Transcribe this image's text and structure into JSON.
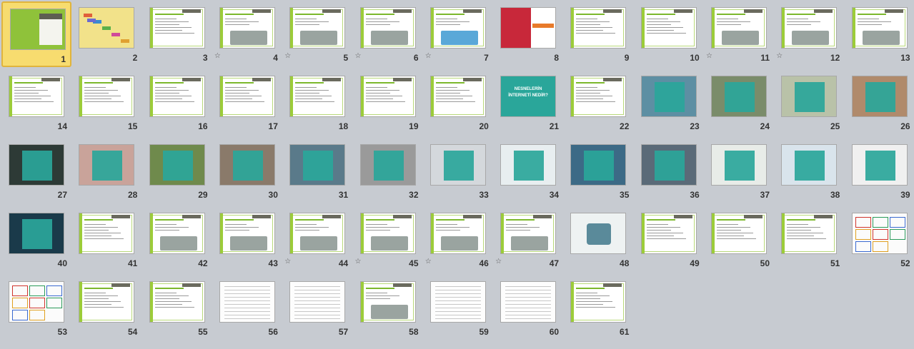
{
  "app": {
    "view": "slide-sorter",
    "accent_color": "#7cb82c",
    "teal_color": "#2aa69a",
    "selected_slide": "1"
  },
  "slides": [
    {
      "number": "1",
      "style": "title-green",
      "star": false
    },
    {
      "number": "2",
      "style": "mindmap",
      "star": false
    },
    {
      "number": "3",
      "style": "text",
      "star": false
    },
    {
      "number": "4",
      "style": "text-image",
      "star": true
    },
    {
      "number": "5",
      "style": "text-image",
      "star": true
    },
    {
      "number": "6",
      "style": "text-image",
      "star": true
    },
    {
      "number": "7",
      "style": "diagram",
      "star": true
    },
    {
      "number": "8",
      "style": "red-image",
      "star": false
    },
    {
      "number": "9",
      "style": "text",
      "star": false
    },
    {
      "number": "10",
      "style": "text",
      "star": false
    },
    {
      "number": "11",
      "style": "text-image",
      "star": true
    },
    {
      "number": "12",
      "style": "text-image",
      "star": true
    },
    {
      "number": "13",
      "style": "text-image",
      "star": false
    },
    {
      "number": "14",
      "style": "text",
      "star": false
    },
    {
      "number": "15",
      "style": "text",
      "star": false
    },
    {
      "number": "16",
      "style": "text",
      "star": false
    },
    {
      "number": "17",
      "style": "text",
      "star": false
    },
    {
      "number": "18",
      "style": "text",
      "star": false
    },
    {
      "number": "19",
      "style": "text",
      "star": false
    },
    {
      "number": "20",
      "style": "text",
      "star": false
    },
    {
      "number": "21",
      "style": "teal-title",
      "star": false,
      "text": "NESNELERİN İNTERNETİ NEDİR?"
    },
    {
      "number": "22",
      "style": "text",
      "star": false
    },
    {
      "number": "23",
      "style": "photo-teal",
      "star": false,
      "photo": "#5d8fa3"
    },
    {
      "number": "24",
      "style": "photo-teal",
      "star": false,
      "photo": "#7a8c6a"
    },
    {
      "number": "25",
      "style": "photo-teal",
      "star": false,
      "photo": "#b9c2a8"
    },
    {
      "number": "26",
      "style": "photo-teal",
      "star": false,
      "photo": "#b08a6b"
    },
    {
      "number": "27",
      "style": "photo-teal",
      "star": false,
      "photo": "#2d3a36"
    },
    {
      "number": "28",
      "style": "photo-teal",
      "star": false,
      "photo": "#c9a39a"
    },
    {
      "number": "29",
      "style": "photo-teal",
      "star": false,
      "photo": "#6f8a4c"
    },
    {
      "number": "30",
      "style": "photo-teal",
      "star": false,
      "photo": "#8a7a6a"
    },
    {
      "number": "31",
      "style": "photo-teal",
      "star": false,
      "photo": "#5a7a8a"
    },
    {
      "number": "32",
      "style": "photo-teal",
      "star": false,
      "photo": "#9a9a9a"
    },
    {
      "number": "33",
      "style": "photo-teal",
      "star": false,
      "photo": "#d4d8dc"
    },
    {
      "number": "34",
      "style": "photo-teal",
      "star": false,
      "photo": "#e8eef0"
    },
    {
      "number": "35",
      "style": "photo-teal",
      "star": false,
      "photo": "#3c6a86"
    },
    {
      "number": "36",
      "style": "photo-teal",
      "star": false,
      "photo": "#5a6a78"
    },
    {
      "number": "37",
      "style": "photo-teal",
      "star": false,
      "photo": "#e8ece8"
    },
    {
      "number": "38",
      "style": "photo-teal",
      "star": false,
      "photo": "#d9e4ec"
    },
    {
      "number": "39",
      "style": "photo-teal",
      "star": false,
      "photo": "#f0f0f0"
    },
    {
      "number": "40",
      "style": "photo-teal",
      "star": false,
      "photo": "#1a3a4a"
    },
    {
      "number": "41",
      "style": "text",
      "star": false
    },
    {
      "number": "42",
      "style": "text-image",
      "star": false
    },
    {
      "number": "43",
      "style": "text-image",
      "star": false
    },
    {
      "number": "44",
      "style": "text-image",
      "star": true
    },
    {
      "number": "45",
      "style": "text-image",
      "star": true
    },
    {
      "number": "46",
      "style": "text-image",
      "star": true
    },
    {
      "number": "47",
      "style": "text-image",
      "star": true
    },
    {
      "number": "48",
      "style": "infographic",
      "star": false
    },
    {
      "number": "49",
      "style": "text",
      "star": false
    },
    {
      "number": "50",
      "style": "text",
      "star": false
    },
    {
      "number": "51",
      "style": "text",
      "star": false
    },
    {
      "number": "52",
      "style": "poster",
      "star": false
    },
    {
      "number": "53",
      "style": "poster",
      "star": false
    },
    {
      "number": "54",
      "style": "text",
      "star": false
    },
    {
      "number": "55",
      "style": "text",
      "star": false
    },
    {
      "number": "56",
      "style": "document",
      "star": false
    },
    {
      "number": "57",
      "style": "document",
      "star": false
    },
    {
      "number": "58",
      "style": "text-image",
      "star": false
    },
    {
      "number": "59",
      "style": "document",
      "star": false
    },
    {
      "number": "60",
      "style": "document",
      "star": false
    },
    {
      "number": "61",
      "style": "text",
      "star": false
    }
  ],
  "icons": {
    "animation": "star-icon"
  }
}
